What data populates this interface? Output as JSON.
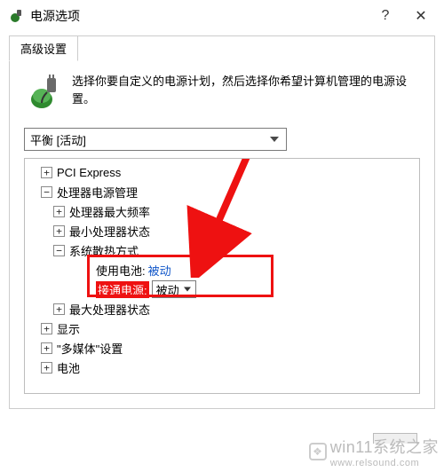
{
  "window": {
    "title": "电源选项",
    "help_glyph": "?",
    "close_glyph": "✕"
  },
  "tabs": {
    "advanced": "高级设置"
  },
  "description": "选择你要自定义的电源计划，然后选择你希望计算机管理的电源设置。",
  "plan_selector": {
    "value": "平衡 [活动]"
  },
  "tree": {
    "pci_express": "PCI Express",
    "cpu_power_mgmt": "处理器电源管理",
    "cpu_max_freq": "处理器最大频率",
    "cpu_min_state": "最小处理器状态",
    "sys_cooling": "系统散热方式",
    "on_battery_label": "使用电池:",
    "on_battery_value": "被动",
    "plugged_in_label": "接通电源:",
    "plugged_in_value": "被动",
    "cpu_max_state": "最大处理器状态",
    "display": "显示",
    "multimedia": "\"多媒体\"设置",
    "battery": "电池"
  },
  "expander": {
    "plus": "+",
    "minus": "−"
  },
  "watermark": {
    "brand": "win11系统之家",
    "url": "www.relsound.com"
  }
}
